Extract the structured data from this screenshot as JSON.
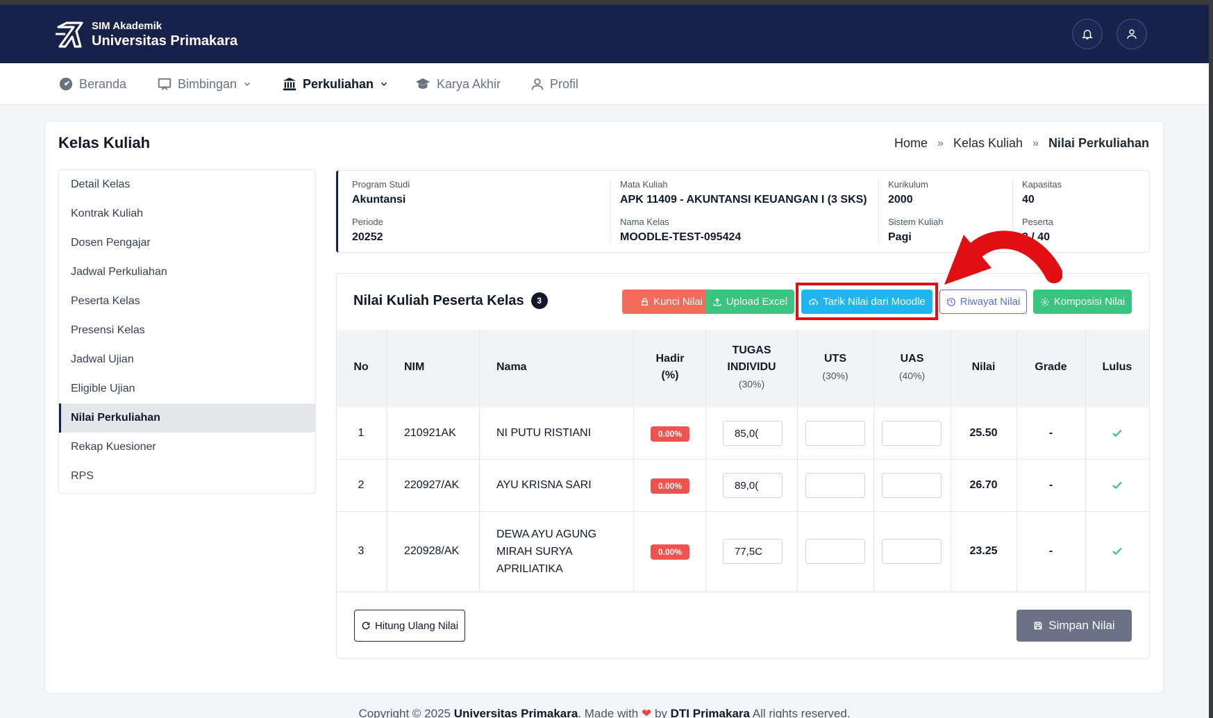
{
  "brand": {
    "subtitle": "SIM Akademik",
    "title": "Universitas Primakara"
  },
  "nav": [
    {
      "label": "Beranda",
      "icon": "gauge-icon"
    },
    {
      "label": "Bimbingan",
      "icon": "presentation-icon",
      "dropdown": true
    },
    {
      "label": "Perkuliahan",
      "icon": "institution-icon",
      "dropdown": true,
      "active": true
    },
    {
      "label": "Karya Akhir",
      "icon": "graduation-cap-icon"
    },
    {
      "label": "Profil",
      "icon": "user-icon"
    }
  ],
  "page": {
    "title": "Kelas Kuliah"
  },
  "breadcrumb": {
    "home": "Home",
    "sep": "»",
    "parent": "Kelas Kuliah",
    "current": "Nilai Perkuliahan"
  },
  "sidemenu": [
    "Detail Kelas",
    "Kontrak Kuliah",
    "Dosen Pengajar",
    "Jadwal Perkuliahan",
    "Peserta Kelas",
    "Presensi Kelas",
    "Jadwal Ujian",
    "Eligible Ujian",
    "Nilai Perkuliahan",
    "Rekap Kuesioner",
    "RPS"
  ],
  "sidemenu_active": "Nilai Perkuliahan",
  "info": {
    "program_studi": {
      "label": "Program Studi",
      "value": "Akuntansi"
    },
    "mata_kuliah": {
      "label": "Mata Kuliah",
      "value": "APK 11409 - AKUNTANSI KEUANGAN I (3 SKS)"
    },
    "kurikulum": {
      "label": "Kurikulum",
      "value": "2000"
    },
    "kapasitas": {
      "label": "Kapasitas",
      "value": "40"
    },
    "periode": {
      "label": "Periode",
      "value": "20252"
    },
    "nama_kelas": {
      "label": "Nama Kelas",
      "value": "MOODLE-TEST-095424"
    },
    "sistem_kuliah": {
      "label": "Sistem Kuliah",
      "value": "Pagi"
    },
    "peserta": {
      "label": "Peserta",
      "value": "3 / 40"
    }
  },
  "grades": {
    "title": "Nilai Kuliah Peserta Kelas",
    "count": "3",
    "buttons": {
      "lock": "Kunci Nilai",
      "upload": "Upload Excel",
      "pull": "Tarik Nilai dari Moodle",
      "history": "Riwayat Nilai",
      "composition": "Komposisi Nilai"
    },
    "columns": {
      "no": "No",
      "nim": "NIM",
      "nama": "Nama",
      "hadir": "Hadir",
      "hadir_sub": "(%)",
      "tugas": "TUGAS",
      "tugas2": "INDIVIDU",
      "tugas_sub": "(30%)",
      "uts": "UTS",
      "uts_sub": "(30%)",
      "uas": "UAS",
      "uas_sub": "(40%)",
      "nilai": "Nilai",
      "grade": "Grade",
      "lulus": "Lulus"
    },
    "rows": [
      {
        "no": "1",
        "nim": "210921AK",
        "nama": "NI PUTU RISTIANI",
        "hadir": "0.00%",
        "tugas": "85,0(",
        "uts": "",
        "uas": "",
        "nilai": "25.50",
        "grade": "-",
        "lulus": true
      },
      {
        "no": "2",
        "nim": "220927/AK",
        "nama": "AYU KRISNA SARI",
        "hadir": "0.00%",
        "tugas": "89,0(",
        "uts": "",
        "uas": "",
        "nilai": "26.70",
        "grade": "-",
        "lulus": true
      },
      {
        "no": "3",
        "nim": "220928/AK",
        "nama_lines": [
          "DEWA AYU AGUNG",
          "MIRAH SURYA",
          "APRILIATIKA"
        ],
        "hadir": "0.00%",
        "tugas": "77,5C",
        "uts": "",
        "uas": "",
        "nilai": "23.25",
        "grade": "-",
        "lulus": true
      }
    ],
    "recalc_label": "Hitung Ulang Nilai",
    "save_label": "Simpan Nilai"
  },
  "footer": {
    "prefix": "Copyright © 2025 ",
    "org": "Universitas Primakara",
    "mid": ". Made with ",
    "by": " by ",
    "team": "DTI Primakara",
    "suffix": " All rights reserved."
  },
  "colors": {
    "header": "#17214a",
    "highlight": "#e20f12",
    "arrow": "#e20f12"
  }
}
